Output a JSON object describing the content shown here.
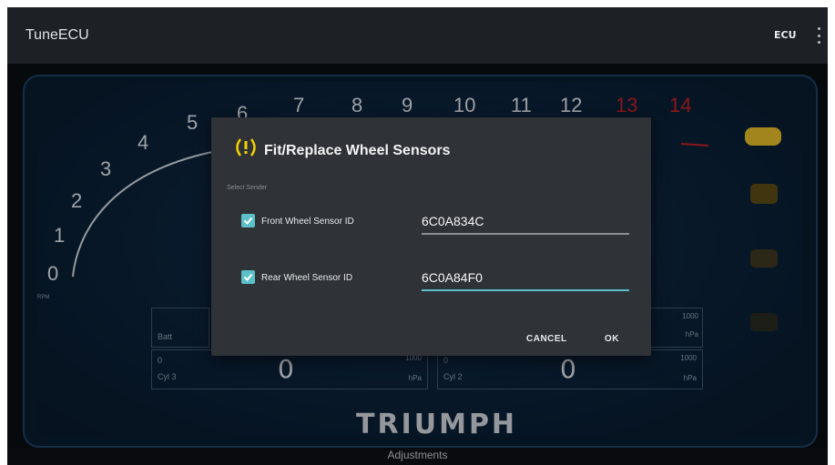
{
  "app": {
    "title": "TuneECU",
    "ecu_label": "ECU"
  },
  "tach": {
    "numbers": [
      "0",
      "1",
      "2",
      "3",
      "4",
      "5",
      "6",
      "7",
      "8",
      "9",
      "10",
      "11",
      "12",
      "13",
      "14"
    ],
    "unit": "RPM",
    "redline_color": "#c82128"
  },
  "gauges": {
    "batt": {
      "label": "Batt"
    },
    "top_right": {
      "unit_top": "1000",
      "unit_bottom": "hPa"
    },
    "cyl3": {
      "prefix": "0",
      "label": "Cyl 3",
      "value": "0",
      "unit_top": "1000",
      "unit_bottom": "hPa"
    },
    "cyl2": {
      "prefix": "0",
      "label": "Cyl 2",
      "value": "0",
      "unit_top": "1000",
      "unit_bottom": "hPa"
    }
  },
  "brand": "TRIUMPH",
  "footer": {
    "label": "Adjustments"
  },
  "dialog": {
    "title": "Fit/Replace Wheel Sensors",
    "subtitle": "Select Sender",
    "front": {
      "label": "Front Wheel Sensor ID",
      "value": "6C0A834C",
      "checked": true
    },
    "rear": {
      "label": "Rear Wheel Sensor ID",
      "value": "6C0A84F0",
      "checked": true
    },
    "cancel_label": "CANCEL",
    "ok_label": "OK",
    "accent": "#5bc0c7",
    "warning_color": "#f2d100"
  }
}
